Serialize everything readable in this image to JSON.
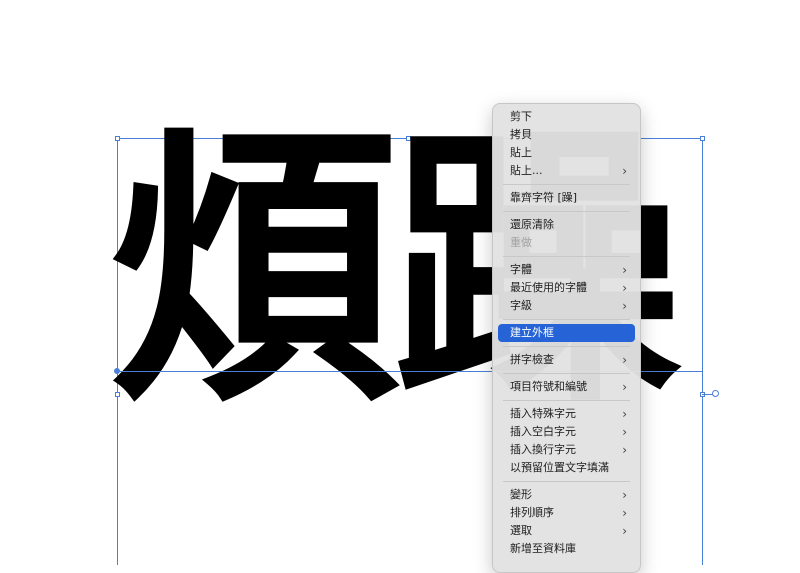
{
  "artwork": {
    "text": "煩躁"
  },
  "context_menu": {
    "groups": [
      {
        "items": [
          {
            "label": "剪下",
            "submenu": false,
            "disabled": false,
            "highlighted": false
          },
          {
            "label": "拷貝",
            "submenu": false,
            "disabled": false,
            "highlighted": false
          },
          {
            "label": "貼上",
            "submenu": false,
            "disabled": false,
            "highlighted": false
          },
          {
            "label": "貼上...",
            "submenu": true,
            "disabled": false,
            "highlighted": false
          }
        ]
      },
      {
        "items": [
          {
            "label": "靠齊字符 [躁]",
            "submenu": false,
            "disabled": false,
            "highlighted": false
          }
        ]
      },
      {
        "items": [
          {
            "label": "還原清除",
            "submenu": false,
            "disabled": false,
            "highlighted": false
          },
          {
            "label": "重做",
            "submenu": false,
            "disabled": true,
            "highlighted": false
          }
        ]
      },
      {
        "items": [
          {
            "label": "字體",
            "submenu": true,
            "disabled": false,
            "highlighted": false
          },
          {
            "label": "最近使用的字體",
            "submenu": true,
            "disabled": false,
            "highlighted": false
          },
          {
            "label": "字級",
            "submenu": true,
            "disabled": false,
            "highlighted": false
          }
        ]
      },
      {
        "items": [
          {
            "label": "建立外框",
            "submenu": false,
            "disabled": false,
            "highlighted": true
          }
        ]
      },
      {
        "items": [
          {
            "label": "拼字檢查",
            "submenu": true,
            "disabled": false,
            "highlighted": false
          }
        ]
      },
      {
        "items": [
          {
            "label": "項目符號和編號",
            "submenu": true,
            "disabled": false,
            "highlighted": false
          }
        ]
      },
      {
        "items": [
          {
            "label": "插入特殊字元",
            "submenu": true,
            "disabled": false,
            "highlighted": false
          },
          {
            "label": "插入空白字元",
            "submenu": true,
            "disabled": false,
            "highlighted": false
          },
          {
            "label": "插入換行字元",
            "submenu": true,
            "disabled": false,
            "highlighted": false
          },
          {
            "label": "以預留位置文字填滿",
            "submenu": false,
            "disabled": false,
            "highlighted": false
          }
        ]
      },
      {
        "items": [
          {
            "label": "變形",
            "submenu": true,
            "disabled": false,
            "highlighted": false
          },
          {
            "label": "排列順序",
            "submenu": true,
            "disabled": false,
            "highlighted": false
          },
          {
            "label": "選取",
            "submenu": true,
            "disabled": false,
            "highlighted": false
          },
          {
            "label": "新增至資料庫",
            "submenu": false,
            "disabled": false,
            "highlighted": false
          }
        ]
      }
    ],
    "submenu_glyph": "›"
  },
  "colors": {
    "selection": "#4a7fd6",
    "menu_highlight": "#2563d6",
    "menu_background": "#e2e2e2",
    "artwork_fill": "#000000"
  }
}
